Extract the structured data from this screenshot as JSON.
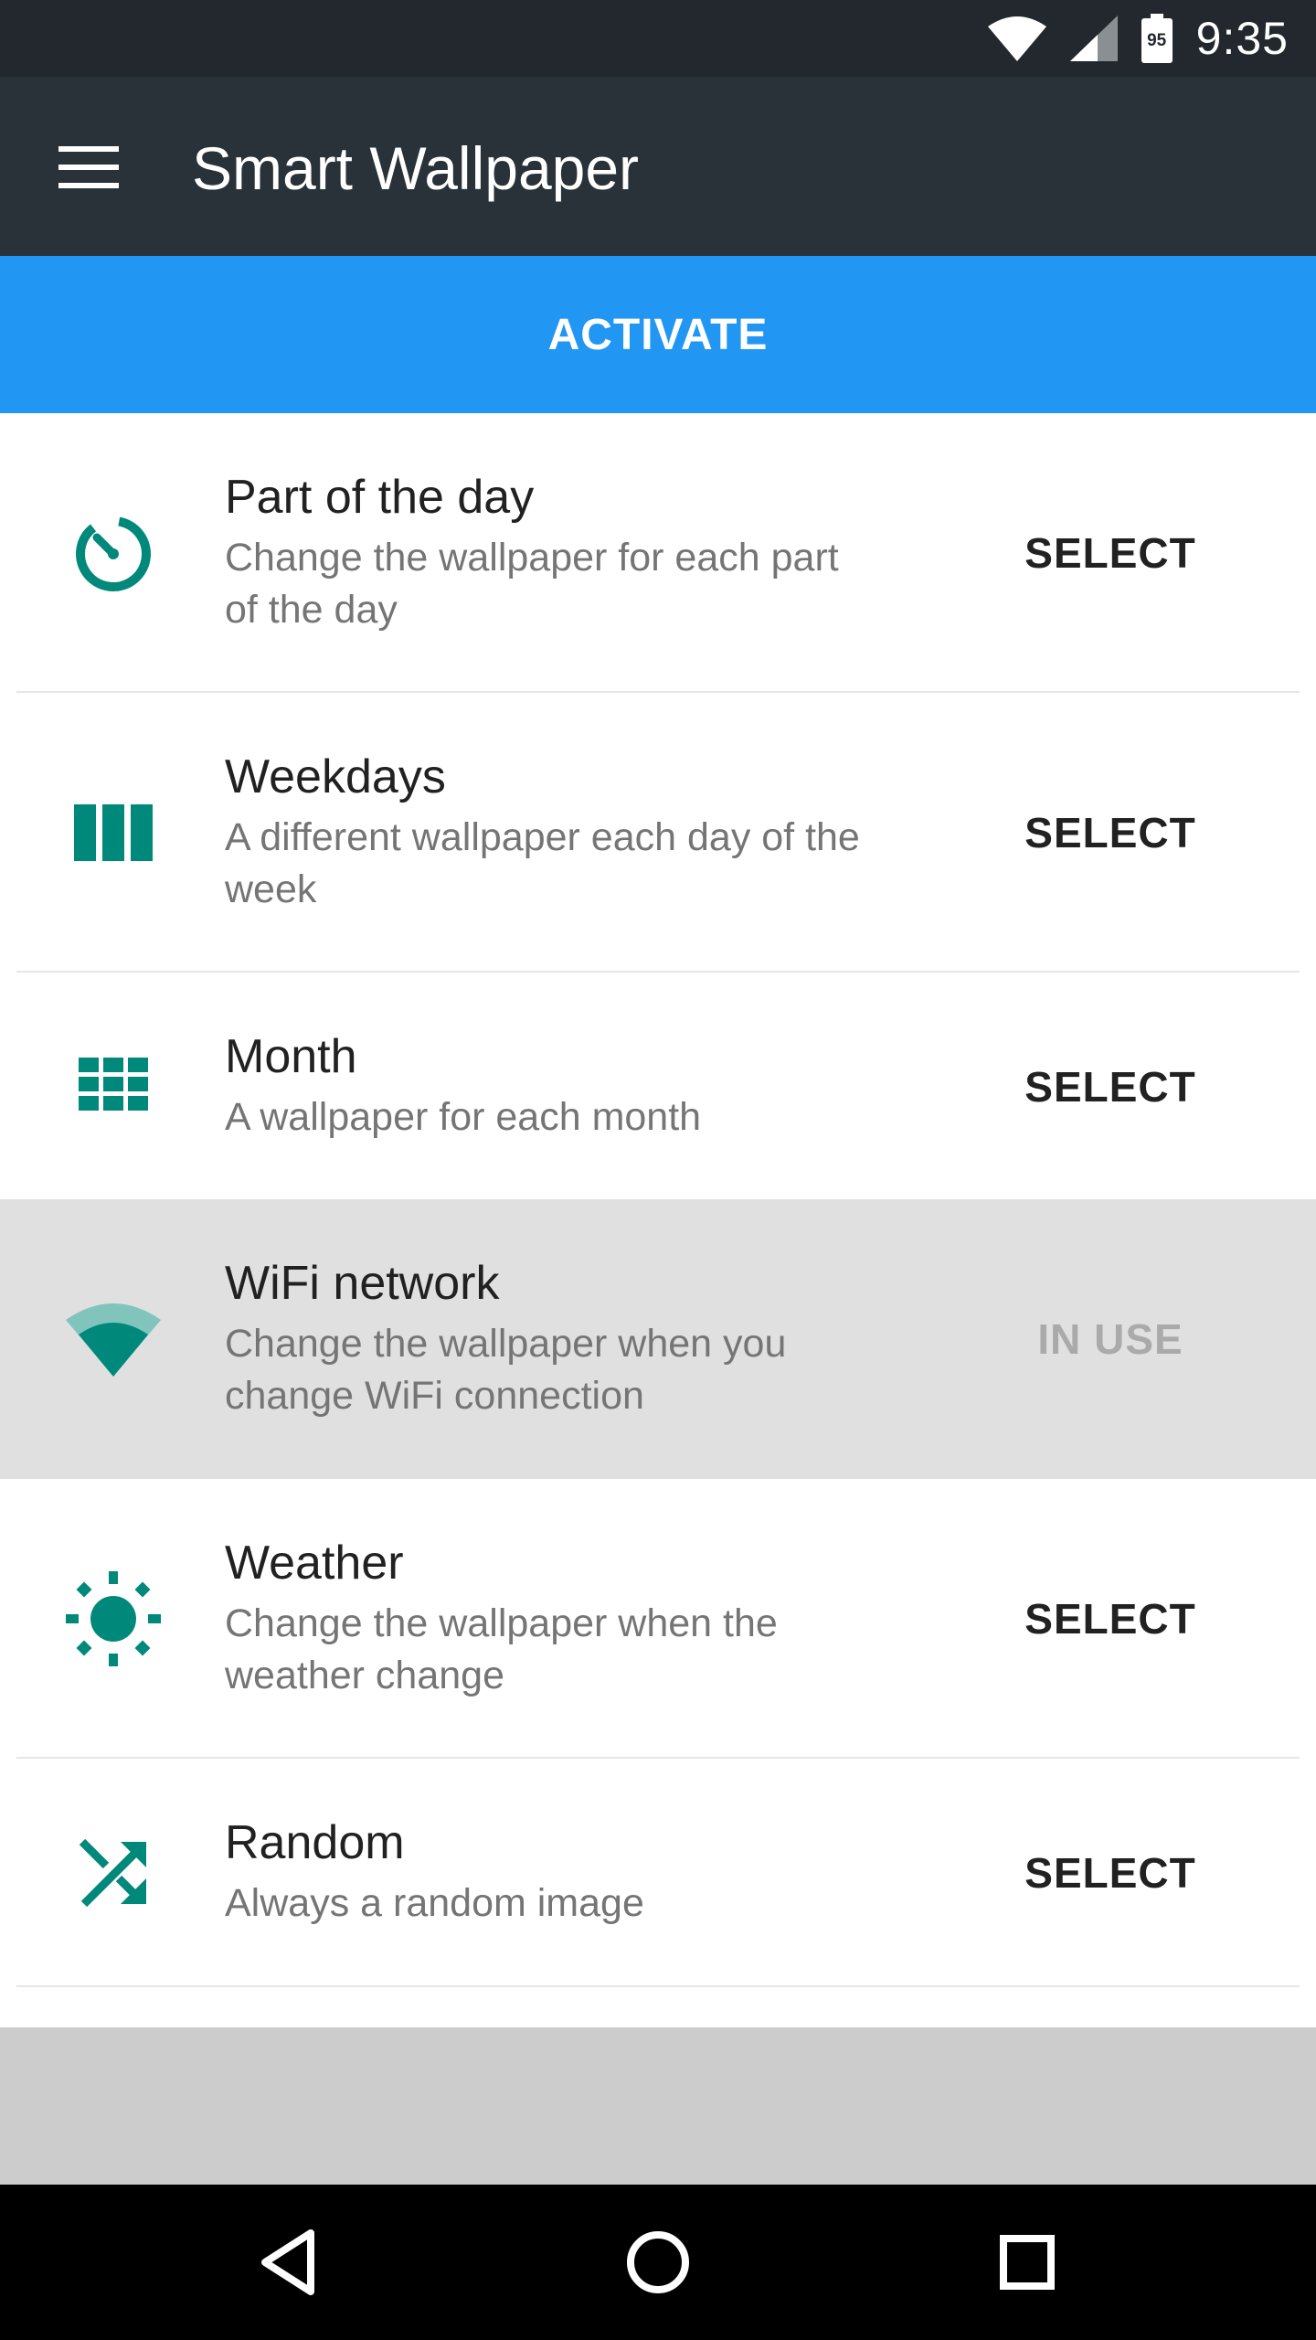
{
  "status_bar": {
    "time": "9:35",
    "battery_level": "95",
    "icons": [
      "wifi-icon",
      "signal-icon",
      "battery-icon"
    ]
  },
  "app_bar": {
    "title": "Smart Wallpaper",
    "menu_icon": "hamburger-menu-icon"
  },
  "activate": {
    "label": "ACTIVATE",
    "color": "#2196f3"
  },
  "accent_color": "#00897b",
  "items": [
    {
      "icon": "timer-icon",
      "label": "Part of the day",
      "desc_line1": "Change the wallpaper for each part",
      "desc_line2": "of the day",
      "action": "SELECT",
      "in_use": false
    },
    {
      "icon": "columns-icon",
      "label": "Weekdays",
      "desc_line1": "A different wallpaper each day of the",
      "desc_line2": "week",
      "action": "SELECT",
      "in_use": false
    },
    {
      "icon": "grid-icon",
      "label": "Month",
      "desc_line1": "A wallpaper for each month",
      "desc_line2": "",
      "action": "SELECT",
      "in_use": false
    },
    {
      "icon": "wifi-icon",
      "label": "WiFi network",
      "desc_line1": "Change the wallpaper when you",
      "desc_line2": "change WiFi connection",
      "action": "IN USE",
      "in_use": true
    },
    {
      "icon": "sun-icon",
      "label": "Weather",
      "desc_line1": "Change the wallpaper when the",
      "desc_line2": "weather change",
      "action": "SELECT",
      "in_use": false
    },
    {
      "icon": "shuffle-icon",
      "label": "Random",
      "desc_line1": "Always a random image",
      "desc_line2": "",
      "action": "SELECT",
      "in_use": false
    }
  ],
  "nav_bar": {
    "back_icon": "back-triangle-icon",
    "home_icon": "home-circle-icon",
    "recents_icon": "recents-square-icon"
  }
}
